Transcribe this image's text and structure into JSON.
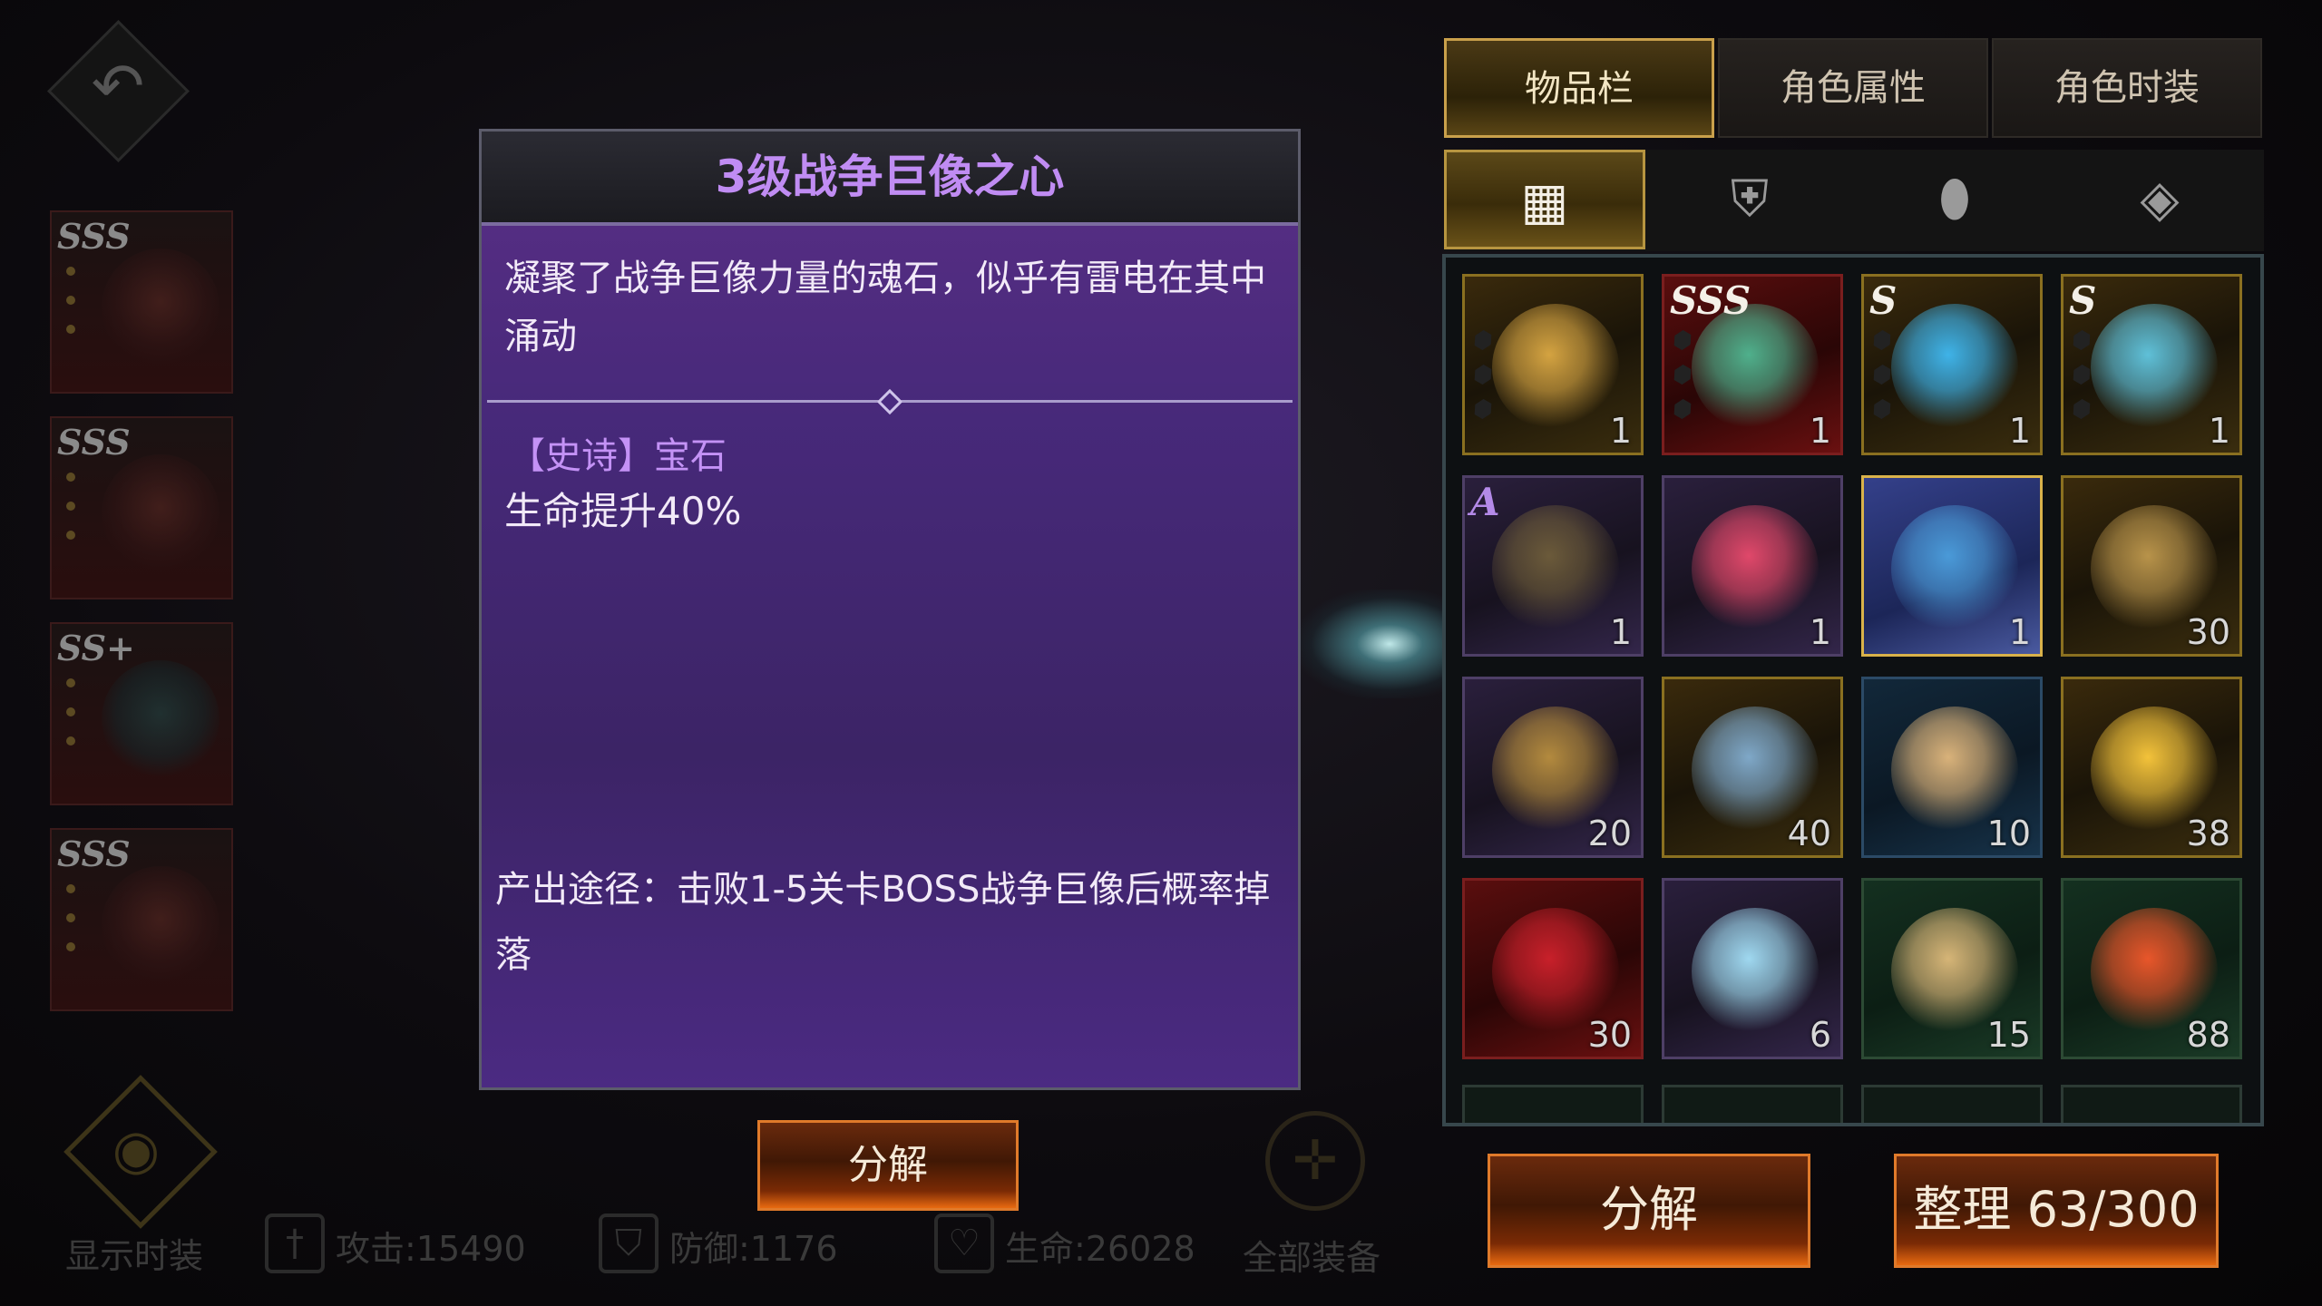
{
  "left_panel": {
    "slots": [
      {
        "rank": "SSS"
      },
      {
        "rank": "SSS"
      },
      {
        "rank": "SS+"
      },
      {
        "rank": "SSS"
      }
    ],
    "show_costume_label": "显示时装",
    "stats": {
      "attack": "攻击:15490",
      "defense": "防御:1176",
      "hp": "生命:26028"
    },
    "all_equip_label": "全部装备"
  },
  "tooltip": {
    "title": "3级战争巨像之心",
    "description": "凝聚了战争巨像力量的魂石，似乎有雷电在其中涌动",
    "quality": "【史诗】宝石",
    "effect": "生命提升40%",
    "source": "产出途径：击败1-5关卡BOSS战争巨像后概率掉落",
    "decompose_label": "分解"
  },
  "right_panel": {
    "tabs": [
      {
        "label": "物品栏",
        "active": true
      },
      {
        "label": "角色属性",
        "active": false
      },
      {
        "label": "角色时装",
        "active": false
      }
    ],
    "subtabs": [
      {
        "icon": "grid-icon",
        "active": true
      },
      {
        "icon": "armor-icon",
        "active": false
      },
      {
        "icon": "gem-icon",
        "active": false
      },
      {
        "icon": "emblem-icon",
        "active": false
      }
    ],
    "items": [
      {
        "name": "amulet",
        "rank": "",
        "count": "1",
        "quality": "orange",
        "color": "#d4a341"
      },
      {
        "name": "spiked-weapon",
        "rank": "SSS",
        "count": "1",
        "quality": "red",
        "color": "#4fb08c"
      },
      {
        "name": "ring",
        "rank": "S",
        "count": "1",
        "quality": "orange",
        "color": "#3fb3e8"
      },
      {
        "name": "pistol",
        "rank": "S",
        "count": "1",
        "quality": "orange",
        "color": "#5fc0d8"
      },
      {
        "name": "gauntlet",
        "rank": "A",
        "count": "1",
        "quality": "purple",
        "color": "#6b5a3a"
      },
      {
        "name": "demon-card",
        "rank": "",
        "count": "1",
        "quality": "purple",
        "color": "#e0486a"
      },
      {
        "name": "king-card",
        "rank": "",
        "count": "1",
        "quality": "gold-lit",
        "color": "#4a9ad8"
      },
      {
        "name": "golden-emblem",
        "rank": "",
        "count": "30",
        "quality": "orange",
        "color": "#b8934a"
      },
      {
        "name": "gears",
        "rank": "",
        "count": "20",
        "quality": "purple",
        "color": "#b38a3e"
      },
      {
        "name": "crystal-shard",
        "rank": "",
        "count": "40",
        "quality": "orange",
        "color": "#7fa8c8"
      },
      {
        "name": "horn",
        "rank": "",
        "count": "10",
        "quality": "blue",
        "color": "#d9b27a"
      },
      {
        "name": "potion",
        "rank": "",
        "count": "38",
        "quality": "orange",
        "color": "#f3c23a"
      },
      {
        "name": "blood-claw",
        "rank": "",
        "count": "30",
        "quality": "red",
        "color": "#c8202a"
      },
      {
        "name": "rainbow-gem",
        "rank": "",
        "count": "6",
        "quality": "purple",
        "color": "#9fd8f0"
      },
      {
        "name": "scroll",
        "rank": "",
        "count": "15",
        "quality": "green",
        "color": "#d6b577"
      },
      {
        "name": "fire-rune",
        "rank": "",
        "count": "88",
        "quality": "green",
        "color": "#e8562a"
      }
    ],
    "decompose_label": "分解",
    "sort_label": "整理 63/300"
  }
}
